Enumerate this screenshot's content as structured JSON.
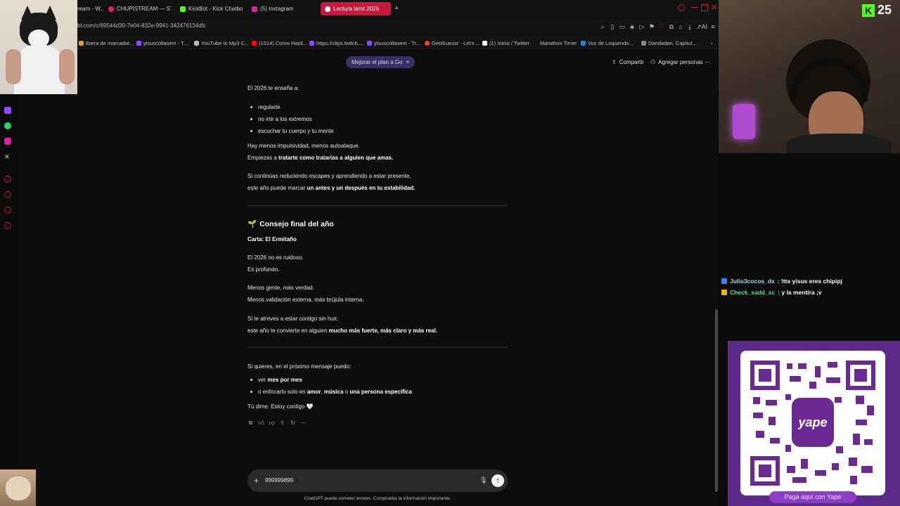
{
  "browser": {
    "tabs": [
      {
        "label": "ream - W...",
        "color": "#7a7a7a"
      },
      {
        "label": "CHUPISTREAM — STREA...",
        "color": "#e0245e"
      },
      {
        "label": "KickBot - Kick Chatbot, A...",
        "color": "#53fc18"
      },
      {
        "label": "(5) Instagram",
        "color": "#d6249f"
      },
      {
        "label": "Lectura tarot 2026",
        "color": "#ffffff"
      }
    ],
    "new_tab": "+",
    "url": "bt.com/c/69544d30-7e04-832e-9941-342476134dfc",
    "bookmarks": [
      {
        "label": "Barra de marcador...",
        "color": "#d9a441"
      },
      {
        "label": "yisuscollasem - T...",
        "color": "#9146ff"
      },
      {
        "label": "YouTube to Mp3 C...",
        "color": "#bbbbbb"
      },
      {
        "label": "(1014) Como Hack...",
        "color": "#ff0000"
      },
      {
        "label": "https://clips.twitch....",
        "color": "#9146ff"
      },
      {
        "label": "yisuscollasem - Tr...",
        "color": "#9146ff"
      },
      {
        "label": "yisuscollasem - Tr...",
        "color": "#9146ff"
      },
      {
        "label": "GeoGuessr - Let's ...",
        "color": "#e6453a"
      },
      {
        "label": "(1) Inicio / Twitter",
        "color": "#ffffff"
      },
      {
        "label": "Marathon Timer",
        "color": "#444444"
      },
      {
        "label": "Voz de Loquendo...",
        "color": "#2e7fd8"
      },
      {
        "label": "Dandadan, Capitul...",
        "color": "#888888"
      }
    ]
  },
  "header": {
    "upgrade_label": "Mejorar el plan a Go",
    "upgrade_close": "×",
    "share_label": "Compartir",
    "add_people_label": "Agregar personas",
    "more": "···"
  },
  "message": {
    "intro": "El 2026 te enseña a:",
    "bullets1": [
      "regularte",
      "no irte a los extremos",
      "escuchar tu cuerpo y tu mente"
    ],
    "p1_line1": "Hay menos impulsividad, menos autoataque.",
    "p1_line2_a": "Empiezas a ",
    "p1_line2_b": "tratarte como tratarías a alguien que amas.",
    "p2_line1": "Si continúas reduciendo escapes y aprendiendo a estar presente,",
    "p2_line2_a": "este año puede marcar ",
    "p2_line2_b": "un antes y un después en tu estabilidad.",
    "section_emoji": "🌱",
    "section_title": "Consejo final del año",
    "card": "Carta: El Ermitaño",
    "p3_line1": "El 2026 no es ruidoso.",
    "p3_line2": "Es profundo.",
    "p4_line1": "Menos gente, más verdad.",
    "p4_line2": "Menos validación externa, más brújula interna.",
    "p5_line1": "Si te atreves a estar contigo sin huir,",
    "p5_line2_a": "este año te convierte en alguien ",
    "p5_line2_b": "mucho más fuerte, más claro y más real.",
    "p6": "Si quieres, en el próximo mensaje puedo:",
    "b2_1_a": "ver ",
    "b2_1_b": "mes por mes",
    "b2_2_a": "o enfocarlo solo en ",
    "b2_2_b": "amor",
    "b2_2_c": ", ",
    "b2_2_d": "música",
    "b2_2_e": " o ",
    "b2_2_f": "una persona específica",
    "closing": "Tú dime. Estoy contigo 🤍"
  },
  "composer": {
    "plus": "+",
    "value": "999999899",
    "send": "↑"
  },
  "disclaimer": "ChatGPT puede cometer errores. Comprueba la información importante.",
  "stream": {
    "kick_logo": "K",
    "viewer_count": "25",
    "chat": [
      {
        "user": "Julio3cocos_dx",
        "text": ": !tts yisus eres chipipj",
        "badge_color": "#3b82f6"
      },
      {
        "user": "Check_sadd_xc",
        "text": ": y la mentira ;v",
        "badge_color": "#f5b301"
      }
    ],
    "qr_logo": "yape",
    "qr_cta": "Paga aquí con Yape"
  }
}
